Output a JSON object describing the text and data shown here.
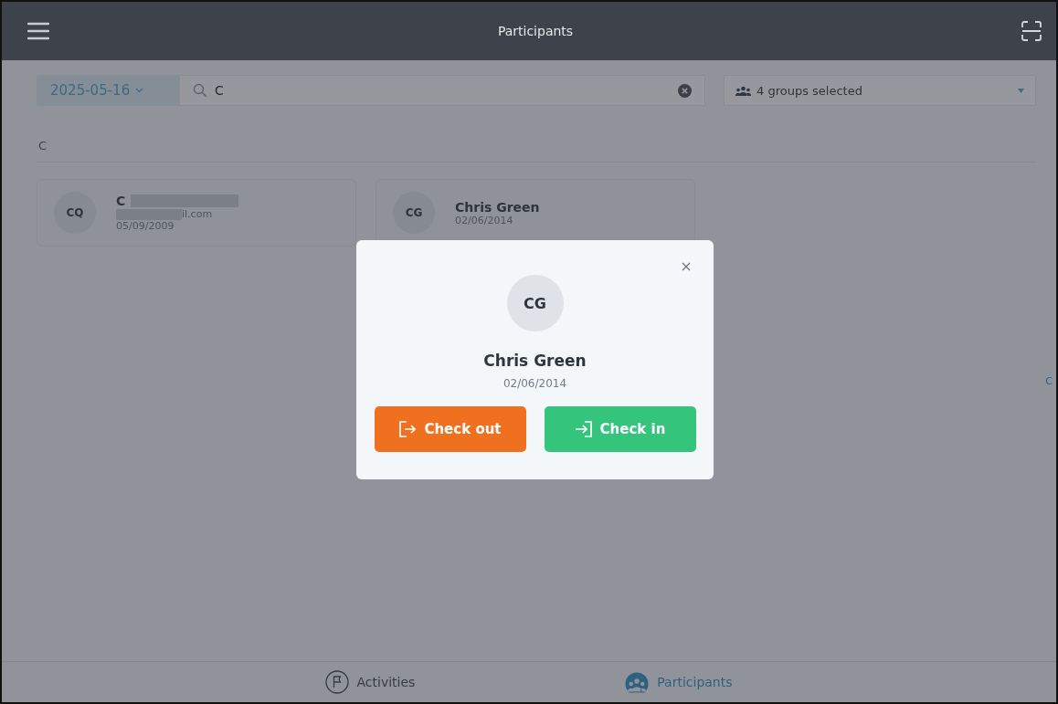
{
  "header": {
    "title": "Participants"
  },
  "filters": {
    "date": "2025-05-16",
    "search": {
      "value": "C"
    },
    "groups": "4 groups selected"
  },
  "section": {
    "letter": "C"
  },
  "participants": [
    {
      "initials": "CQ",
      "name": "C",
      "email": "il.com",
      "birthdate": "05/09/2009",
      "redacted": true
    },
    {
      "initials": "CG",
      "name": "Chris Green",
      "birthdate": "02/06/2014",
      "redacted": false
    }
  ],
  "index": [
    "C"
  ],
  "dialog": {
    "initials": "CG",
    "name": "Chris Green",
    "birthdate": "02/06/2014",
    "buttons": [
      {
        "kind": "checkout",
        "label": "Check out"
      },
      {
        "kind": "checkin",
        "label": "Check in"
      }
    ]
  },
  "nav": [
    {
      "label": "Activities",
      "kind": "activities",
      "selected": false
    },
    {
      "label": "Participants",
      "kind": "participants",
      "selected": true
    }
  ]
}
